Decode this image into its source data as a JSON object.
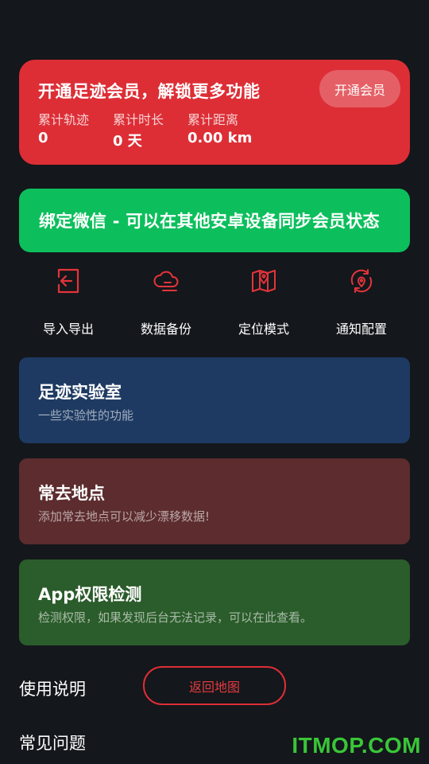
{
  "membership": {
    "title": "开通足迹会员，解锁更多功能",
    "button_label": "开通会员",
    "stats": [
      {
        "label": "累计轨迹",
        "value": "0"
      },
      {
        "label": "累计时长",
        "value": "0 天"
      },
      {
        "label": "累计距离",
        "value": "0.00 km"
      }
    ]
  },
  "wechat_bind": {
    "text": "绑定微信 - 可以在其他安卓设备同步会员状态"
  },
  "tools": [
    {
      "label": "导入导出",
      "icon": "import-export-icon"
    },
    {
      "label": "数据备份",
      "icon": "cloud-backup-icon"
    },
    {
      "label": "定位模式",
      "icon": "map-location-icon"
    },
    {
      "label": "通知配置",
      "icon": "notification-refresh-icon"
    }
  ],
  "features": [
    {
      "title": "足迹实验室",
      "description": "一些实验性的功能",
      "color": "#1e3a62"
    },
    {
      "title": "常去地点",
      "description": "添加常去地点可以减少漂移数据!",
      "color": "#5c2c2e"
    },
    {
      "title": "App权限检测",
      "description": "检测权限，如果发现后台无法记录，可以在此查看。",
      "color": "#2b5c2b"
    }
  ],
  "help": {
    "usage_label": "使用说明",
    "faq_label": "常见问题",
    "back_button_label": "返回地图"
  },
  "watermark": "ITMOP.COM",
  "colors": {
    "background": "#14171b",
    "accent_red": "#dd2e36",
    "wechat_green": "#0cbf5c"
  }
}
